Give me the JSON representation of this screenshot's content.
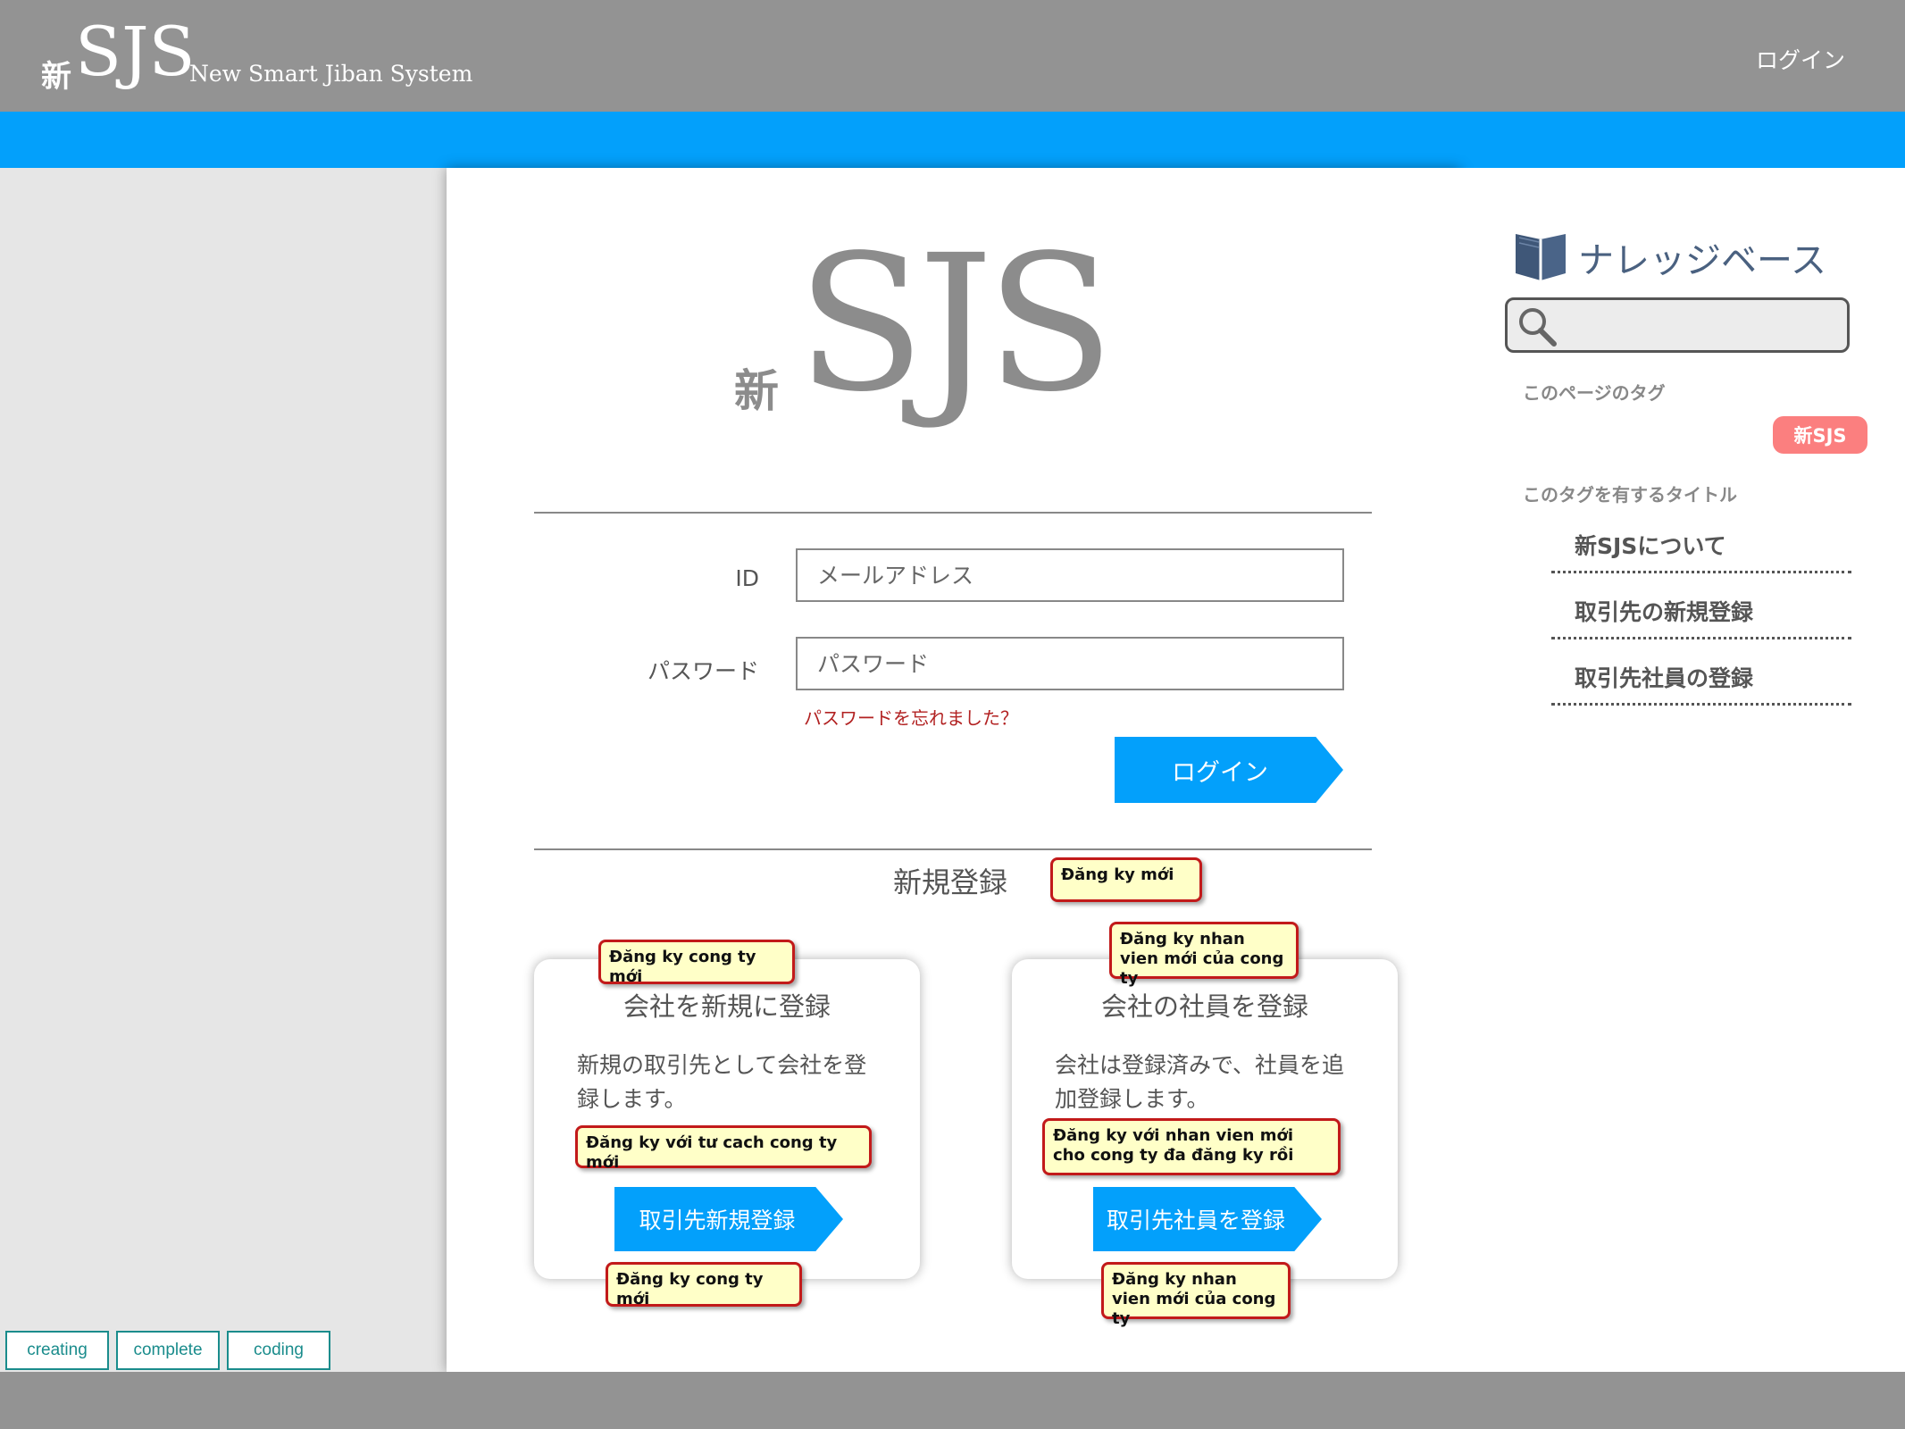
{
  "header": {
    "logo_kanji": "新",
    "logo_text": "SJS",
    "logo_tagline": "New Smart Jiban System",
    "login_link": "ログイン"
  },
  "main": {
    "logo_kanji": "新",
    "logo_text": "SJS",
    "id_label": "ID",
    "id_placeholder": "メールアドレス",
    "password_label": "パスワード",
    "password_placeholder": "パスワード",
    "forgot_link": "パスワードを忘れました？",
    "login_button": "ログイン",
    "register_title": "新規登録",
    "cards": [
      {
        "title": "会社を新規に登録",
        "description": "新規の取引先として会社を登録します。",
        "button": "取引先新規登録"
      },
      {
        "title": "会社の社員を登録",
        "description": "会社は登録済みで、社員を追加登録します。",
        "button": "取引先社員を登録"
      }
    ]
  },
  "notes": {
    "register_title": "Đăng ky mới",
    "card1_title": "Đăng ky cong ty mới",
    "card1_desc": "Đăng ky với tư cach cong ty mới",
    "card1_button": "Đăng ky cong ty mới",
    "card2_title": "Đăng ky nhan vien mới của cong ty",
    "card2_desc": "Đăng ky với nhan vien mới cho cong ty đa đăng ky rồi",
    "card2_button": "Đăng ky nhan vien mới của cong ty"
  },
  "status_tags": [
    "creating",
    "complete",
    "coding"
  ],
  "knowledge_base": {
    "title": "ナレッジベース",
    "icon": "book-icon",
    "search_icon": "magnifier-icon",
    "page_tags_label": "このページのタグ",
    "tag": "新SJS",
    "titles_label": "このタグを有するタイトル",
    "links": [
      "新SJSについて",
      "取引先の新規登録",
      "取引先社員の登録"
    ]
  },
  "colors": {
    "header_gray": "#939393",
    "accent_blue": "#03a0fb",
    "tag_pink": "#fb7f7f",
    "forgot_red": "#b22222",
    "note_fill": "#ffffc8",
    "note_border": "#c21a1a",
    "status_teal": "#1a8c8c"
  }
}
